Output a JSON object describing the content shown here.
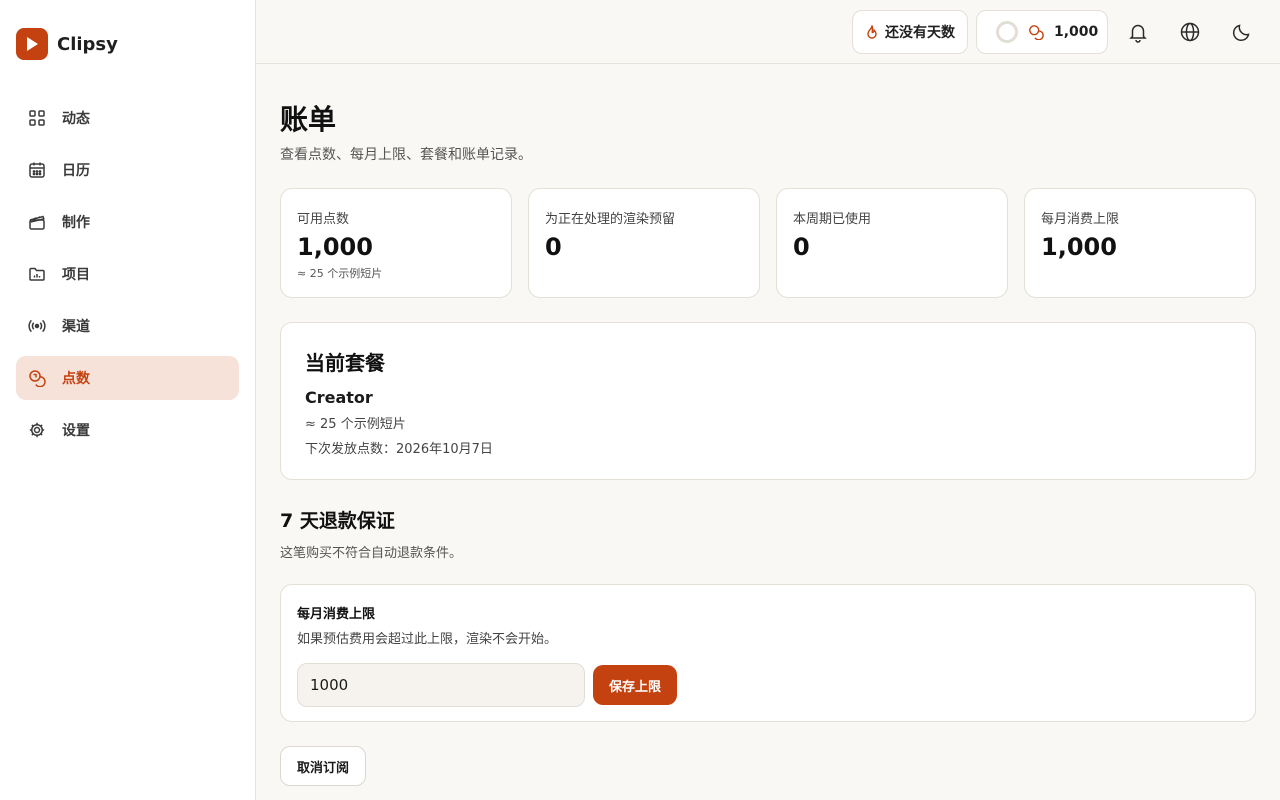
{
  "app": {
    "name": "Clipsy"
  },
  "colors": {
    "accent": "#c4420f",
    "active_bg": "#f6e2d9"
  },
  "sidebar": {
    "items": [
      {
        "label": "动态",
        "icon": "grid-icon"
      },
      {
        "label": "日历",
        "icon": "calendar-icon"
      },
      {
        "label": "制作",
        "icon": "clapper-icon"
      },
      {
        "label": "项目",
        "icon": "folder-chart-icon"
      },
      {
        "label": "渠道",
        "icon": "broadcast-icon"
      },
      {
        "label": "点数",
        "icon": "coins-icon",
        "active": true
      },
      {
        "label": "设置",
        "icon": "gear-icon"
      }
    ]
  },
  "topbar": {
    "streak_label": "还没有天数",
    "points_value": "1,000"
  },
  "page": {
    "title": "账单",
    "subtitle": "查看点数、每月上限、套餐和账单记录。"
  },
  "stats": [
    {
      "label": "可用点数",
      "value": "1,000",
      "hint": "≈ 25 个示例短片"
    },
    {
      "label": "为正在处理的渲染预留",
      "value": "0"
    },
    {
      "label": "本周期已使用",
      "value": "0"
    },
    {
      "label": "每月消费上限",
      "value": "1,000"
    }
  ],
  "plan": {
    "heading": "当前套餐",
    "name": "Creator",
    "estimate": "≈ 25 个示例短片",
    "next_grant": "下次发放点数：2026年10月7日"
  },
  "refund": {
    "title": "7 天退款保证",
    "note": "这笔购买不符合自动退款条件。"
  },
  "spend_cap": {
    "title": "每月消费上限",
    "description": "如果预估费用会超过此上限，渲染不会开始。",
    "value": "1000",
    "save_label": "保存上限"
  },
  "cancel_label": "取消订阅"
}
